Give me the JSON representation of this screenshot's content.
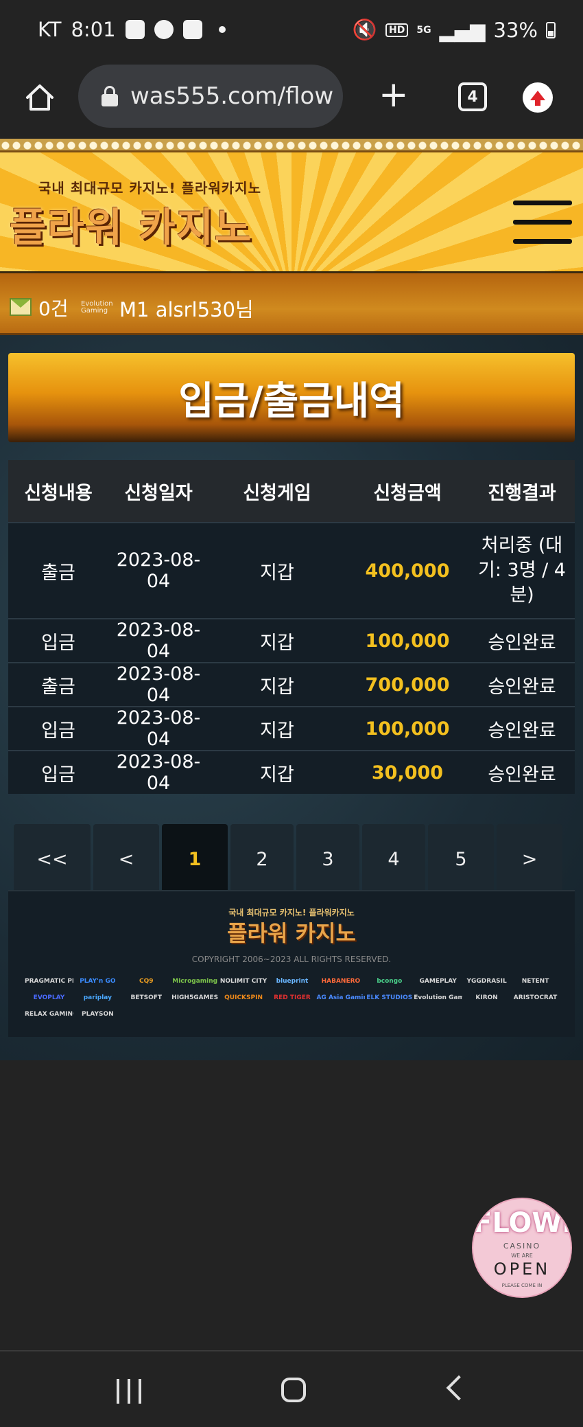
{
  "status_bar": {
    "carrier": "KT",
    "time": "8:01",
    "net_badge": "HD",
    "signal_label": "5G",
    "battery": "33%"
  },
  "browser": {
    "url": "was555.com/flow",
    "tab_count": "4",
    "plus_label": "+"
  },
  "site": {
    "logo_tagline": "국내 최대규모 카지노! 플라워카지노",
    "logo_name": "플라워 카지노"
  },
  "user_bar": {
    "message_count": "0건",
    "evo_logo": "Evolution Gaming",
    "user_label": "M1 alsrl530님"
  },
  "page": {
    "title": "입금/출금내역"
  },
  "table": {
    "headers": [
      "신청내용",
      "신청일자",
      "신청게임",
      "신청금액",
      "진행결과"
    ],
    "rows": [
      {
        "type": "출금",
        "date": "2023-08-04",
        "game": "지갑",
        "amount": "400,000",
        "result": "처리중 (대기: 3명 / 4분)"
      },
      {
        "type": "입금",
        "date": "2023-08-04",
        "game": "지갑",
        "amount": "100,000",
        "result": "승인완료"
      },
      {
        "type": "출금",
        "date": "2023-08-04",
        "game": "지갑",
        "amount": "700,000",
        "result": "승인완료"
      },
      {
        "type": "입금",
        "date": "2023-08-04",
        "game": "지갑",
        "amount": "100,000",
        "result": "승인완료"
      },
      {
        "type": "입금",
        "date": "2023-08-04",
        "game": "지갑",
        "amount": "30,000",
        "result": "승인완료"
      }
    ]
  },
  "pagination": {
    "first": "<<",
    "prev": "<",
    "pages": [
      "1",
      "2",
      "3",
      "4",
      "5"
    ],
    "active_page": "1",
    "next": ">"
  },
  "footer": {
    "tagline": "국내 최대규모 카지노! 플라워카지노",
    "logo": "플라워 카지노",
    "copyright": "COPYRIGHT 2006~2023 ALL RIGHTS RESERVED.",
    "providers": [
      "PRAGMATIC PLAY",
      "PLAY'n GO",
      "CQ9",
      "Microgaming",
      "NOLIMIT CITY",
      "blueprint",
      "HABANERO",
      "bcongo",
      "GAMEPLAY",
      "YGGDRASIL",
      "NETENT",
      "EVOPLAY",
      "pariplay",
      "BETSOFT",
      "HIGH5GAMES",
      "QUICKSPIN",
      "RED TIGER",
      "AG Asia Gaming",
      "ELK STUDIOS",
      "Evolution Gaming",
      "KIRON",
      "ARISTOCRAT",
      "RELAX GAMING",
      "PLAYSON"
    ]
  },
  "promo": {
    "big": "FLOWER",
    "casino": "CASINO",
    "we_are": "WE ARE",
    "open": "OPEN",
    "come": "PLEASE COME IN"
  },
  "colors": {
    "accent_gold": "#f3c01f",
    "header_orange": "#f7b625",
    "table_bg": "#141e26"
  }
}
